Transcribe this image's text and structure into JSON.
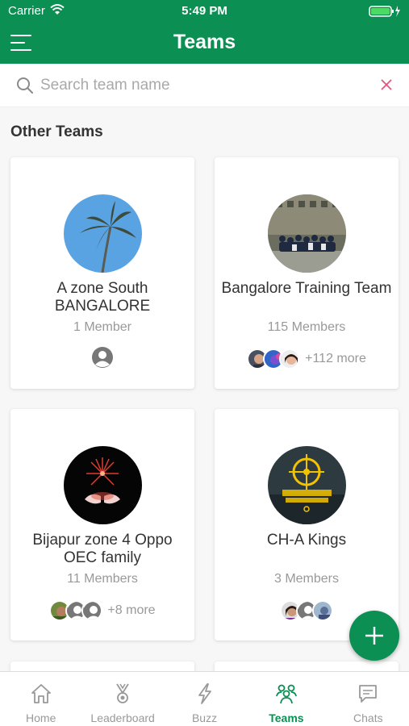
{
  "status_bar": {
    "carrier": "Carrier",
    "time": "5:49 PM"
  },
  "header": {
    "title": "Teams"
  },
  "search": {
    "placeholder": "Search team name",
    "value": ""
  },
  "section": {
    "title": "Other Teams"
  },
  "teams": [
    {
      "name": "A zone South BANGALORE",
      "members_count": "1 Member",
      "more": ""
    },
    {
      "name": "Bangalore Training Team",
      "members_count": "115 Members",
      "more": "+112 more"
    },
    {
      "name": "Bijapur zone 4 Oppo OEC family",
      "members_count": "11 Members",
      "more": "+8 more"
    },
    {
      "name": "CH-A Kings",
      "members_count": "3 Members",
      "more": ""
    }
  ],
  "tabs": [
    {
      "label": "Home",
      "icon": "home-icon"
    },
    {
      "label": "Leaderboard",
      "icon": "trophy-icon"
    },
    {
      "label": "Buzz",
      "icon": "lightning-icon"
    },
    {
      "label": "Teams",
      "icon": "people-icon",
      "active": true
    },
    {
      "label": "Chats",
      "icon": "chat-icon"
    }
  ],
  "colors": {
    "primary": "#0b8f53",
    "clear_icon": "#e5537b",
    "muted_text": "#999999"
  }
}
